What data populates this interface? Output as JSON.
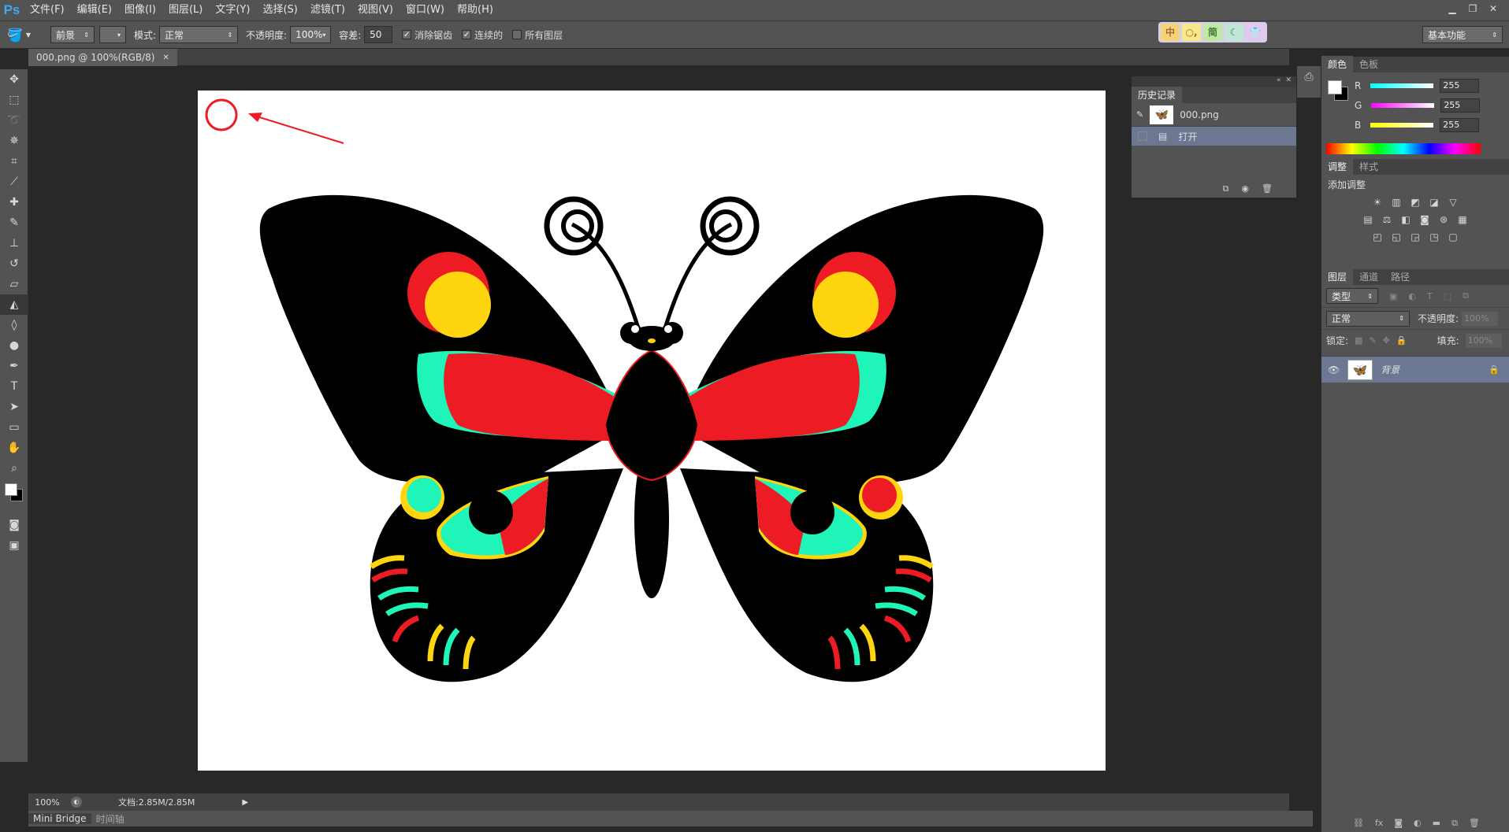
{
  "menubar": {
    "logo": "Ps",
    "items": [
      "文件(F)",
      "编辑(E)",
      "图像(I)",
      "图层(L)",
      "文字(Y)",
      "选择(S)",
      "滤镜(T)",
      "视图(V)",
      "窗口(W)",
      "帮助(H)"
    ]
  },
  "options": {
    "fill_source": "前景",
    "mode_label": "模式:",
    "mode_value": "正常",
    "opacity_label": "不透明度:",
    "opacity_value": "100%",
    "tolerance_label": "容差:",
    "tolerance_value": "50",
    "antialias_label": "消除锯齿",
    "antialias_checked": true,
    "contiguous_label": "连续的",
    "contiguous_checked": true,
    "all_layers_label": "所有图层",
    "all_layers_checked": false,
    "workspace": "基本功能"
  },
  "ime": [
    "中",
    "○,",
    "简",
    "☾",
    "👕"
  ],
  "document": {
    "tab_title": "000.png @ 100%(RGB/8)",
    "zoom": "100%",
    "doc_info": "文档:2.85M/2.85M"
  },
  "bottom_tabs": [
    "Mini Bridge",
    "时间轴"
  ],
  "history": {
    "tab": "历史记录",
    "snapshot": "000.png",
    "step": "打开"
  },
  "color_panel": {
    "tabs": [
      "颜色",
      "色板"
    ],
    "r_label": "R",
    "r_value": "255",
    "g_label": "G",
    "g_value": "255",
    "b_label": "B",
    "b_value": "255"
  },
  "adjust_panel": {
    "tabs": [
      "调整",
      "样式"
    ],
    "title": "添加调整"
  },
  "layers_panel": {
    "tabs": [
      "图层",
      "通道",
      "路径"
    ],
    "filter": "类型",
    "blend": "正常",
    "opacity_label": "不透明度:",
    "opacity_value": "100%",
    "lock_label": "锁定:",
    "fill_label": "填充:",
    "fill_value": "100%",
    "layer_name": "背景"
  },
  "colors": {
    "accent": "#ed1c24",
    "teal": "#1ff5b8",
    "yellow": "#ffd50f",
    "panel_bg": "#535353",
    "workspace_bg": "#282828"
  }
}
